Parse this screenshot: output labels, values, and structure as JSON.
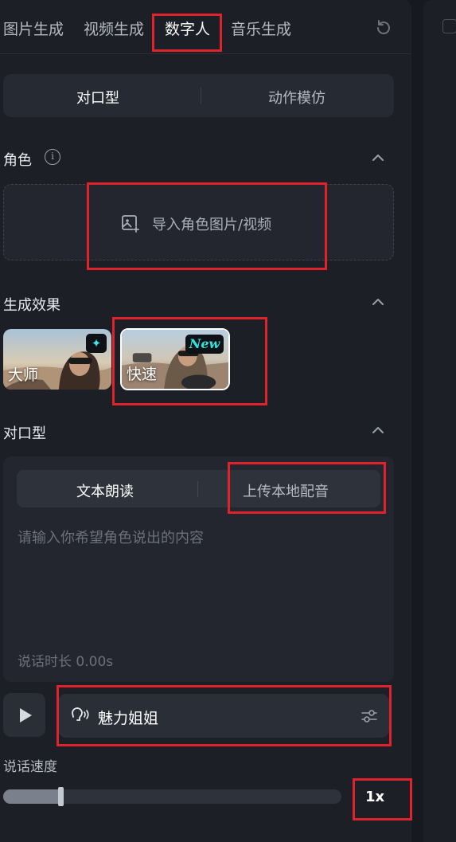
{
  "tabs": [
    "图片生成",
    "视频生成",
    "数字人",
    "音乐生成"
  ],
  "active_tab": "数字人",
  "mode": {
    "options": [
      "对口型",
      "动作模仿"
    ],
    "selected": "对口型"
  },
  "role": {
    "title": "角色",
    "import_label": "导入角色图片/视频"
  },
  "effect": {
    "title": "生成效果",
    "options": [
      {
        "label": "大师",
        "badge": "✦"
      },
      {
        "label": "快速",
        "badge": "New"
      }
    ],
    "selected": "快速"
  },
  "lipsync": {
    "title": "对口型",
    "options": [
      "文本朗读",
      "上传本地配音"
    ],
    "selected": "文本朗读",
    "placeholder": "请输入你希望角色说出的内容",
    "duration": "说话时长 0.00s"
  },
  "voice": {
    "name": "魅力姐姐"
  },
  "speed": {
    "title": "说话速度",
    "value_label": "1x",
    "value": 0.17
  },
  "colors": {
    "background": "#1c1f26",
    "highlight": "#e0222c",
    "accent_tag": "#2fe3dc"
  }
}
